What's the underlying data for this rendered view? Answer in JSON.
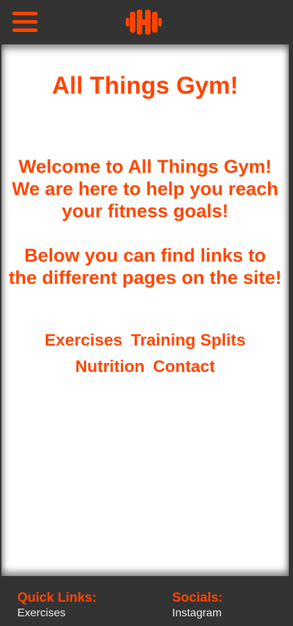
{
  "colors": {
    "accent": "#ff4500",
    "bar": "#333333",
    "content_bg": "#ffffff"
  },
  "header": {
    "menu_icon": "hamburger-icon",
    "logo_icon": "dumbbell-icon"
  },
  "main": {
    "title": "All Things Gym!",
    "intro": "Welcome to All Things Gym! We are here to help you reach your fitness goals!",
    "intro_2": "Below you can find links to the different pages on the site!",
    "links": [
      "Exercises",
      "Training Splits",
      "Nutrition",
      "Contact"
    ]
  },
  "footer": {
    "quick_links": {
      "heading": "Quick Links:",
      "items": [
        "Exercises"
      ]
    },
    "socials": {
      "heading": "Socials:",
      "items": [
        "Instagram"
      ]
    }
  }
}
